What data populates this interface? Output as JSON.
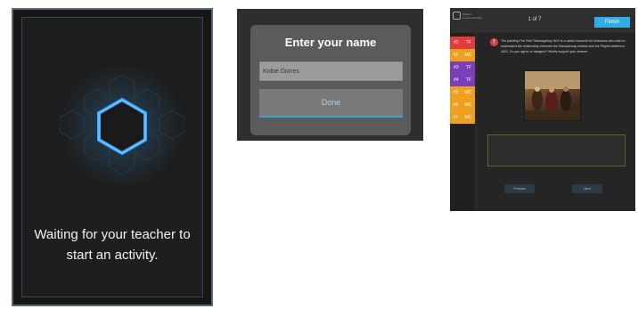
{
  "waiting_screen": {
    "message": "Waiting for your teacher to start an activity."
  },
  "name_entry": {
    "title": "Enter your name",
    "name_value": "Kobie Dorres",
    "done_label": "Done"
  },
  "quiz": {
    "brand_line1": "Kahoot!",
    "brand_line2": "Lesson Activities",
    "count": "1 of 7",
    "finish_label": "Finish",
    "question_text": "The painting The First Thanksgiving 1621 is a useful resource for historians who wish to understand the relationship between the Wampanoag Indians and the Pilgrim settlers in 1621. Do you agree or disagree? Briefly support your answer.",
    "previous_label": "Previous",
    "next_label": "Next",
    "items": [
      {
        "num": "#1",
        "type": "TF",
        "color": "#e23b3b"
      },
      {
        "num": "#2",
        "type": "MC",
        "color": "#f0a020"
      },
      {
        "num": "#3",
        "type": "TF",
        "color": "#7a3fb8"
      },
      {
        "num": "#4",
        "type": "TF",
        "color": "#7a3fb8"
      },
      {
        "num": "#5",
        "type": "MC",
        "color": "#f0a020"
      },
      {
        "num": "#6",
        "type": "MC",
        "color": "#f0a020"
      },
      {
        "num": "#7",
        "type": "MC",
        "color": "#f0a020"
      }
    ]
  },
  "colors": {
    "accent_blue": "#2eaee8",
    "glow_blue": "#2a8fe0"
  }
}
